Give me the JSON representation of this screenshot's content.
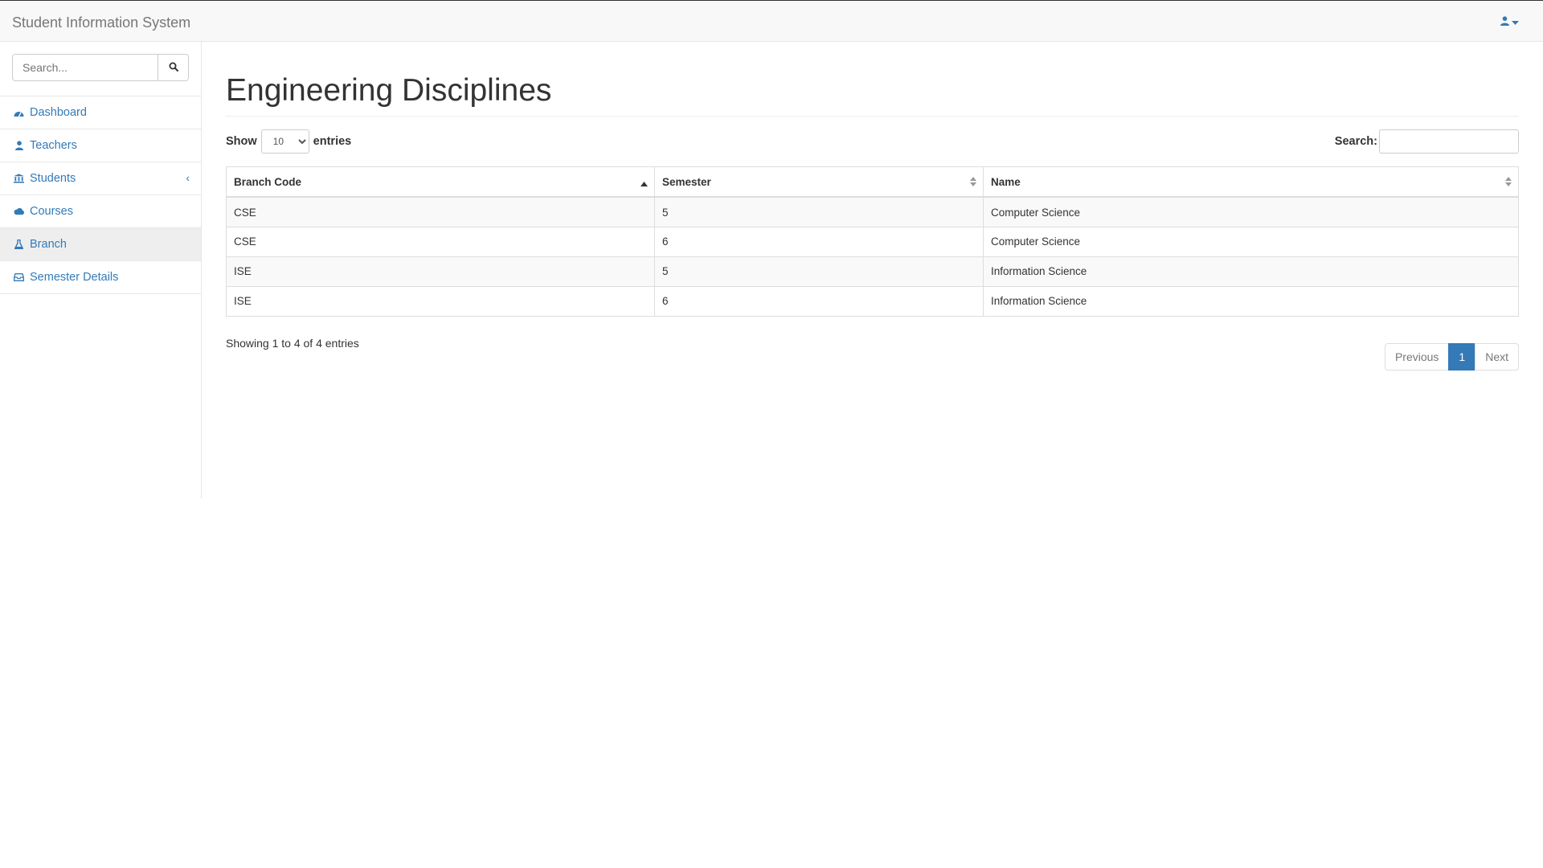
{
  "app": {
    "brand": "Student Information System"
  },
  "topbar": {
    "user_icon": "user-icon",
    "dropdown_icon": "caret-down-icon"
  },
  "sidebar": {
    "search_placeholder": "Search...",
    "search_icon": "search-icon",
    "items": [
      {
        "label": "Dashboard",
        "icon": "dashboard-icon"
      },
      {
        "label": "Teachers",
        "icon": "user-icon"
      },
      {
        "label": "Students",
        "icon": "institution-icon",
        "expandable": true
      },
      {
        "label": "Courses",
        "icon": "cloud-icon"
      },
      {
        "label": "Branch",
        "icon": "flask-icon",
        "active": true
      },
      {
        "label": "Semester Details",
        "icon": "inbox-icon"
      }
    ]
  },
  "page": {
    "title": "Engineering Disciplines"
  },
  "table_controls": {
    "show_label": "Show",
    "entries_value": "10",
    "entries_label": "entries",
    "search_label": "Search:"
  },
  "table": {
    "columns": [
      "Branch Code",
      "Semester",
      "Name"
    ],
    "rows": [
      [
        "CSE",
        "5",
        "Computer Science"
      ],
      [
        "CSE",
        "6",
        "Computer Science"
      ],
      [
        "ISE",
        "5",
        "Information Science"
      ],
      [
        "ISE",
        "6",
        "Information Science"
      ]
    ]
  },
  "footer": {
    "info": "Showing 1 to 4 of 4 entries",
    "pagination": {
      "previous": "Previous",
      "current": "1",
      "next": "Next"
    }
  },
  "colors": {
    "link": "#337ab7",
    "active_page": "#337ab7",
    "navbar_bg": "#f8f8f8"
  }
}
